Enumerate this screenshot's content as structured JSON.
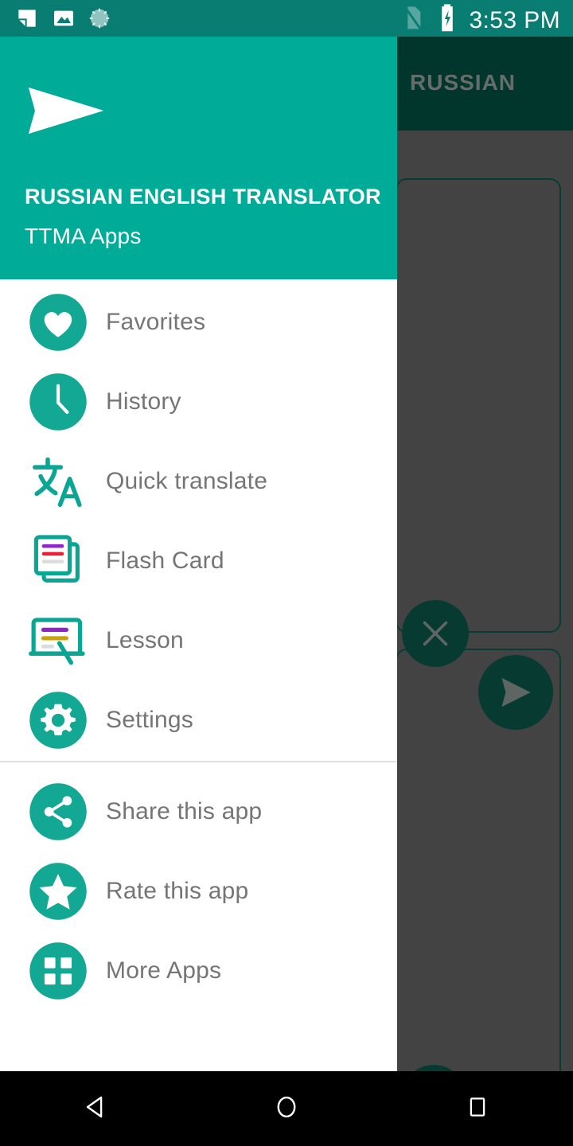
{
  "status_bar": {
    "time": "3:53 PM",
    "left_icons": [
      "screenshot-icon",
      "image-icon",
      "sync-spinner-icon"
    ],
    "right_icons": [
      "no-sim-icon",
      "battery-charging-icon"
    ],
    "background_color": "#0a7d73"
  },
  "background_app": {
    "toolbar_title": "RUSSIAN",
    "toolbar_color": "#005243",
    "scrim_color": "#666666",
    "cards": [
      {
        "name": "source-text-card"
      },
      {
        "name": "target-text-card"
      }
    ],
    "buttons": [
      {
        "name": "clear-button",
        "icon": "close-icon"
      },
      {
        "name": "send-button",
        "icon": "send-icon"
      },
      {
        "name": "speak-button",
        "icon": "volume-up-icon"
      }
    ]
  },
  "drawer": {
    "header": {
      "logo_icon": "paper-plane-logo",
      "title": "RUSSIAN ENGLISH TRANSLATOR",
      "subtitle": "TTMA Apps",
      "background_color": "#00ab98"
    },
    "primary_items": [
      {
        "label": "Favorites",
        "icon": "heart-icon"
      },
      {
        "label": "History",
        "icon": "clock-icon"
      },
      {
        "label": "Quick translate",
        "icon": "translate-icon"
      },
      {
        "label": "Flash Card",
        "icon": "flash-card-icon"
      },
      {
        "label": "Lesson",
        "icon": "lesson-board-icon"
      },
      {
        "label": "Settings",
        "icon": "gear-icon"
      }
    ],
    "secondary_items": [
      {
        "label": "Share this app",
        "icon": "share-icon"
      },
      {
        "label": "Rate this app",
        "icon": "star-icon"
      },
      {
        "label": "More Apps",
        "icon": "grid-apps-icon"
      }
    ],
    "accent_color": "#12a894",
    "label_color": "#757575"
  },
  "nav_bar": {
    "buttons": [
      {
        "name": "back-button",
        "icon": "triangle-back-icon"
      },
      {
        "name": "home-button",
        "icon": "circle-home-icon"
      },
      {
        "name": "recents-button",
        "icon": "square-recents-icon"
      }
    ]
  }
}
